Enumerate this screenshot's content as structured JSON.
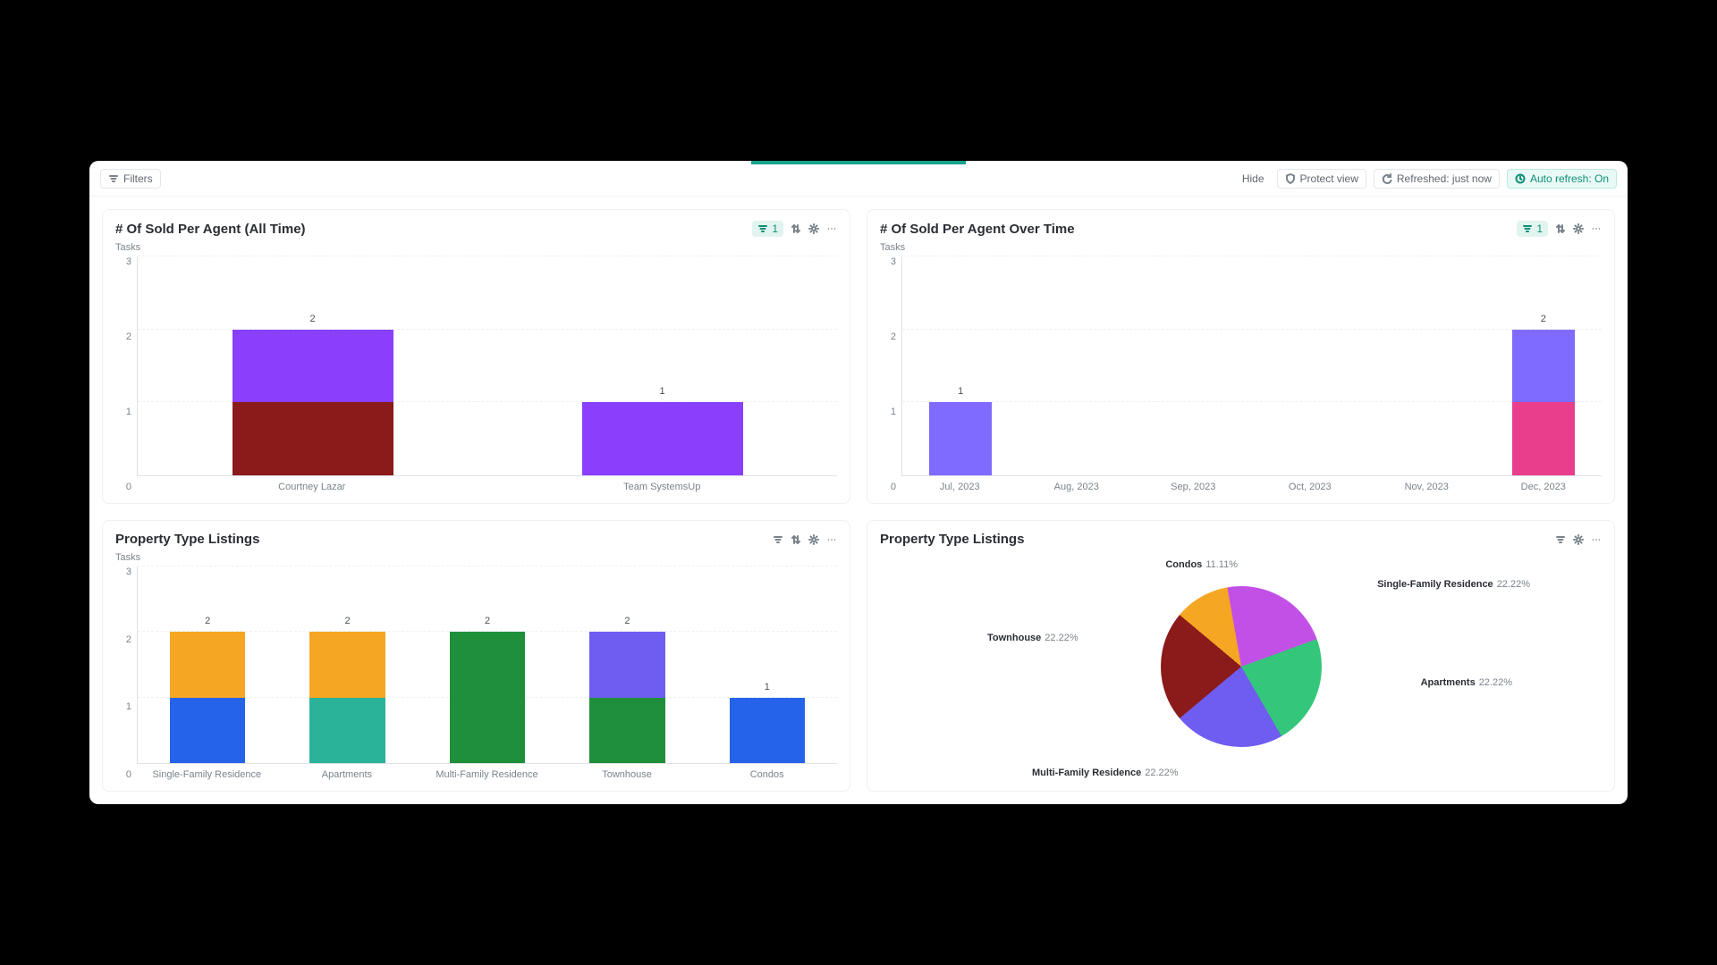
{
  "toolbar": {
    "filters": "Filters",
    "hide": "Hide",
    "protect": "Protect view",
    "refreshed": "Refreshed: just now",
    "auto_refresh": "Auto refresh: On"
  },
  "cards": {
    "sold_agent_all": {
      "title": "# Of Sold Per Agent (All Time)",
      "axis": "Tasks",
      "filter_count": "1"
    },
    "sold_agent_time": {
      "title": "# Of Sold Per Agent Over Time",
      "axis": "Tasks",
      "filter_count": "1"
    },
    "prop_type_bar": {
      "title": "Property Type Listings",
      "axis": "Tasks"
    },
    "prop_type_pie": {
      "title": "Property Type Listings"
    }
  },
  "labels": {
    "pie": {
      "condos": "Condos",
      "condos_pct": "11.11%",
      "sfr": "Single-Family Residence",
      "sfr_pct": "22.22%",
      "apt": "Apartments",
      "apt_pct": "22.22%",
      "mfr": "Multi-Family Residence",
      "mfr_pct": "22.22%",
      "town": "Townhouse",
      "town_pct": "22.22%"
    }
  },
  "chart_data": [
    {
      "id": "sold_agent_all",
      "type": "bar",
      "stacked": true,
      "ylabel": "Tasks",
      "ylim": [
        0,
        3
      ],
      "yticks": [
        0,
        1,
        2,
        3
      ],
      "categories": [
        "Courtney Lazar",
        "Team SystemsUp"
      ],
      "series": [
        {
          "name": "segA",
          "color": "#8b1a1a",
          "values": [
            1,
            0
          ]
        },
        {
          "name": "segB",
          "color": "#8a3ffc",
          "values": [
            1,
            1
          ]
        }
      ],
      "totals": [
        2,
        1
      ]
    },
    {
      "id": "sold_agent_time",
      "type": "bar",
      "stacked": true,
      "ylabel": "Tasks",
      "ylim": [
        0,
        3
      ],
      "yticks": [
        0,
        1,
        2,
        3
      ],
      "categories": [
        "Jul, 2023",
        "Aug, 2023",
        "Sep, 2023",
        "Oct, 2023",
        "Nov, 2023",
        "Dec, 2023"
      ],
      "series": [
        {
          "name": "segA",
          "color": "#e83e8c",
          "values": [
            0,
            0,
            0,
            0,
            0,
            1
          ]
        },
        {
          "name": "segB",
          "color": "#7f6bff",
          "values": [
            1,
            0,
            0,
            0,
            0,
            1
          ]
        }
      ],
      "totals": [
        1,
        0,
        0,
        0,
        0,
        2
      ]
    },
    {
      "id": "prop_type_bar",
      "type": "bar",
      "stacked": true,
      "ylabel": "Tasks",
      "ylim": [
        0,
        3
      ],
      "yticks": [
        0,
        1,
        2,
        3
      ],
      "categories": [
        "Single-Family Residence",
        "Apartments",
        "Multi-Family Residence",
        "Townhouse",
        "Condos"
      ],
      "series": [
        {
          "name": "segBottom",
          "colors": [
            "#2563eb",
            "#2bb39a",
            "#1f8f3b",
            "#1f8f3b",
            "#2563eb"
          ],
          "values": [
            1,
            1,
            1,
            1,
            1
          ]
        },
        {
          "name": "segTop",
          "colors": [
            "#f5a623",
            "#f5a623",
            "#1f8f3b",
            "#6f5cf0",
            null
          ],
          "values": [
            1,
            1,
            1,
            1,
            0
          ]
        }
      ],
      "totals": [
        2,
        2,
        2,
        2,
        1
      ]
    },
    {
      "id": "prop_type_pie",
      "type": "pie",
      "slices": [
        {
          "label": "Condos",
          "value": 11.11,
          "color": "#f5a623"
        },
        {
          "label": "Single-Family Residence",
          "value": 22.22,
          "color": "#c350e6"
        },
        {
          "label": "Apartments",
          "value": 22.22,
          "color": "#34c77b"
        },
        {
          "label": "Multi-Family Residence",
          "value": 22.22,
          "color": "#6f5cf0"
        },
        {
          "label": "Townhouse",
          "value": 22.22,
          "color": "#8b1a1a"
        }
      ]
    }
  ]
}
